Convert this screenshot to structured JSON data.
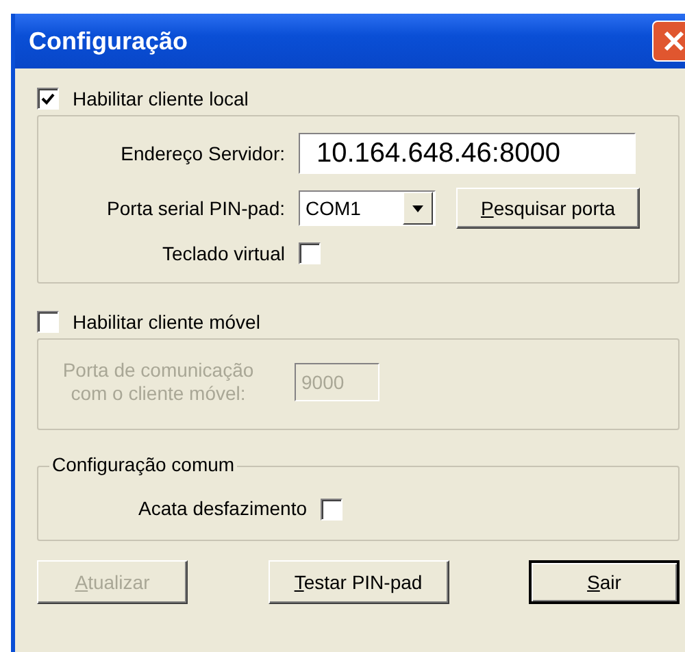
{
  "window": {
    "title": "Configuração"
  },
  "local_client": {
    "label": "Habilitar cliente local",
    "checked": true,
    "server_address": {
      "label": "Endereço Servidor:",
      "value": "10.164.648.46:8000"
    },
    "serial_port": {
      "label": "Porta serial PIN-pad:",
      "value": "COM1"
    },
    "search_button": {
      "label": "Pesquisar porta"
    },
    "virtual_keyboard": {
      "label": "Teclado virtual",
      "checked": false
    }
  },
  "mobile_client": {
    "label": "Habilitar cliente móvel",
    "checked": false,
    "disabled": true,
    "port": {
      "label_lines": [
        "Porta de comunicação",
        "com o cliente móvel:"
      ],
      "value": "9000"
    }
  },
  "common": {
    "title": "Configuração comum",
    "undo": {
      "label": "Acata desfazimento",
      "checked": false
    }
  },
  "buttons": [
    {
      "label": "Atualizar",
      "disabled": true,
      "default": false
    },
    {
      "label": "Testar PIN-pad",
      "disabled": false,
      "default": false
    },
    {
      "label": "Sair",
      "disabled": false,
      "default": true
    }
  ]
}
